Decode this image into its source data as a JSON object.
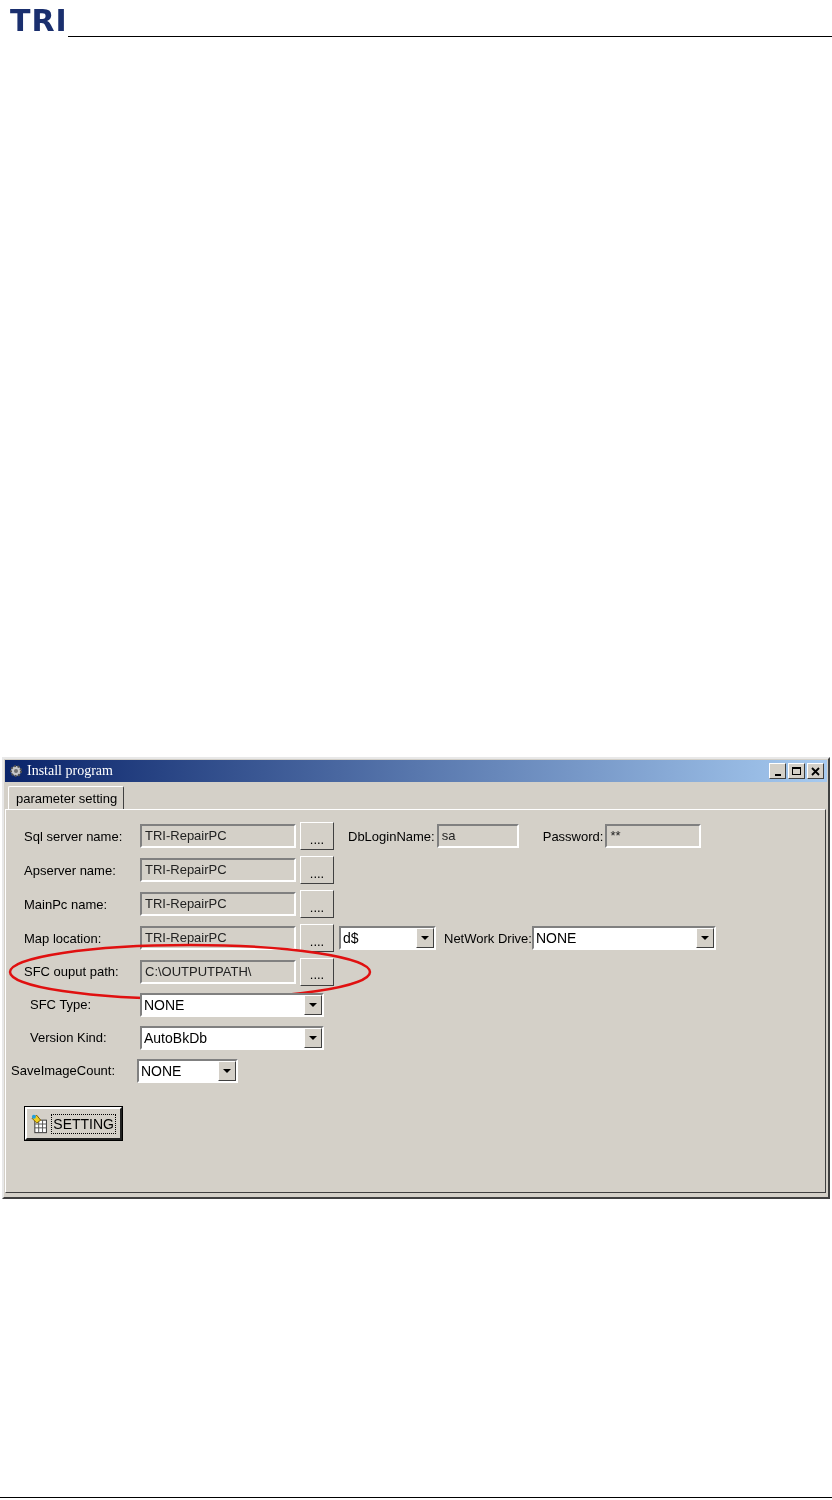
{
  "header": {
    "logo": "TRI"
  },
  "window": {
    "title": "Install program",
    "controls": [
      {
        "kind": "minimize"
      },
      {
        "kind": "maximize"
      },
      {
        "kind": "close"
      }
    ],
    "tabs": [
      {
        "label": "parameter setting",
        "selected": true
      }
    ],
    "rows": [
      {
        "highlighted": false,
        "items": [
          {
            "kind": "label",
            "text": "Sql server name:"
          },
          {
            "kind": "field",
            "value": "TRI-RepairPC",
            "disabled": true
          },
          {
            "kind": "browse",
            "text": "...."
          },
          {
            "kind": "label",
            "text": "DbLoginName:"
          },
          {
            "kind": "field",
            "value": "sa",
            "disabled": true
          },
          {
            "kind": "label",
            "text": "Password:"
          },
          {
            "kind": "field",
            "value": "**",
            "disabled": true
          }
        ]
      },
      {
        "highlighted": false,
        "items": [
          {
            "kind": "label",
            "text": "Apserver name:"
          },
          {
            "kind": "field",
            "value": "TRI-RepairPC",
            "disabled": true
          },
          {
            "kind": "browse",
            "text": "...."
          }
        ]
      },
      {
        "highlighted": false,
        "items": [
          {
            "kind": "label",
            "text": "MainPc name:"
          },
          {
            "kind": "field",
            "value": "TRI-RepairPC",
            "disabled": true
          },
          {
            "kind": "browse",
            "text": "...."
          }
        ]
      },
      {
        "highlighted": false,
        "items": [
          {
            "kind": "label",
            "text": "Map location:"
          },
          {
            "kind": "field",
            "value": "TRI-RepairPC",
            "disabled": true
          },
          {
            "kind": "browse",
            "text": "...."
          },
          {
            "kind": "combo",
            "value": "d$"
          },
          {
            "kind": "label",
            "text": "NetWork Drive:"
          },
          {
            "kind": "combo",
            "value": "NONE"
          }
        ]
      },
      {
        "highlighted": true,
        "items": [
          {
            "kind": "label",
            "text": "SFC ouput path:"
          },
          {
            "kind": "field",
            "value": "C:\\OUTPUTPATH\\",
            "disabled": true
          },
          {
            "kind": "browse",
            "text": "...."
          }
        ]
      },
      {
        "highlighted": false,
        "items": [
          {
            "kind": "label",
            "text": "SFC Type:"
          },
          {
            "kind": "combo",
            "value": "NONE"
          }
        ]
      },
      {
        "highlighted": false,
        "items": [
          {
            "kind": "label",
            "text": "Version Kind:"
          },
          {
            "kind": "combo",
            "value": "AutoBkDb"
          }
        ]
      },
      {
        "highlighted": false,
        "items": [
          {
            "kind": "label",
            "text": "SaveImageCount:"
          },
          {
            "kind": "combo",
            "value": "NONE"
          }
        ]
      }
    ],
    "action_button": {
      "label": "SETTING"
    }
  }
}
